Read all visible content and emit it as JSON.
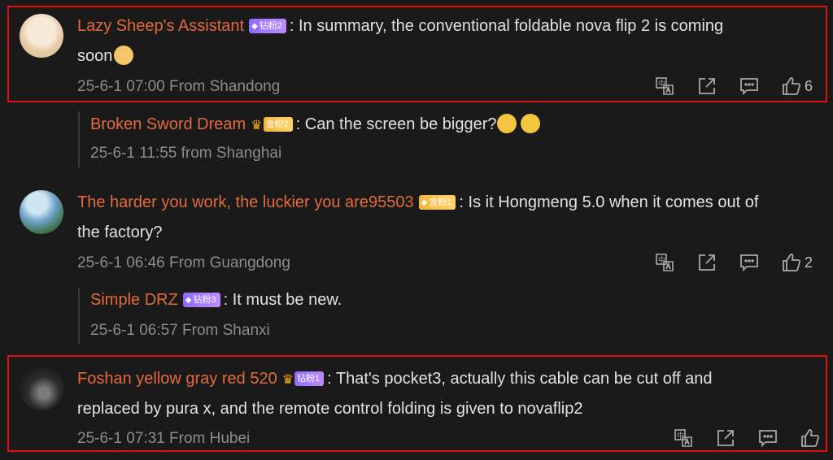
{
  "comments": [
    {
      "author": "Lazy Sheep's Assistant",
      "badge": "钻粉2",
      "text_line1": ": In summary, the conventional foldable nova flip 2 is coming",
      "text_line2": "soon",
      "meta": "25-6-1 07:00 From Shandong",
      "likes": "6"
    },
    {
      "author": "The harder you work, the luckier you are95503",
      "badge": "金粉1",
      "text_line1": ": Is it Hongmeng 5.0 when it comes out of",
      "text_line2": "the factory?",
      "meta": "25-6-1 06:46 From Guangdong",
      "likes": "2"
    },
    {
      "author": "Foshan yellow gray red 520",
      "badge": "钻粉1",
      "text_line1": ": That's pocket3, actually this cable can be cut off and",
      "text_line2": "replaced by pura x, and the remote control folding is given to novaflip2",
      "meta": "25-6-1 07:31 From Hubei",
      "likes": ""
    }
  ],
  "replies": [
    {
      "author": "Broken Sword Dream",
      "badge": "金粉2",
      "text": ": Can the screen be bigger?",
      "meta": "25-6-1 11:55 from Shanghai"
    },
    {
      "author": "Simple DRZ",
      "badge": "钻粉3",
      "text": ": It must be new.",
      "meta": "25-6-1 06:57 From Shanxi"
    }
  ],
  "icons": [
    "translate-icon",
    "share-icon",
    "comment-icon",
    "like-icon"
  ],
  "colors": {
    "username": "#e36a3b",
    "highlight": "#e01010",
    "meta": "#8c8c8c"
  }
}
